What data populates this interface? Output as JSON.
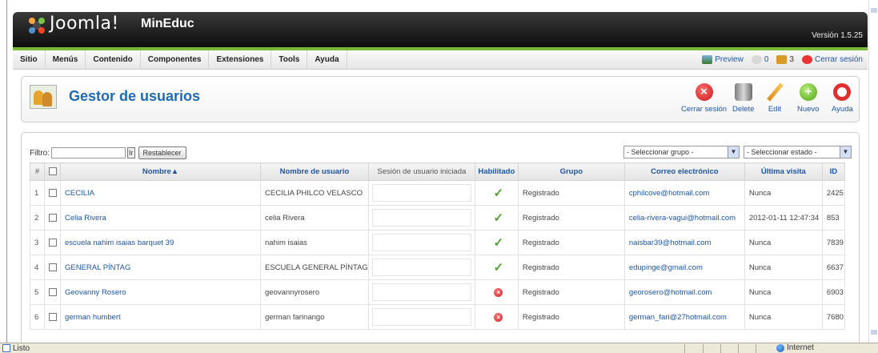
{
  "header": {
    "brand": "Joomla!",
    "site": "MinEduc",
    "version": "Versión 1.5.25"
  },
  "menu": {
    "items": [
      "Sitio",
      "Menús",
      "Contenido",
      "Componentes",
      "Extensiones",
      "Tools",
      "Ayuda"
    ],
    "preview": "Preview",
    "messages": "0",
    "users": "3",
    "logout": "Cerrar sesión"
  },
  "toolbar": {
    "title": "Gestor de usuarios",
    "buttons": [
      "Cerrar sesión",
      "Delete",
      "Edit",
      "Nuevo",
      "Ayuda"
    ]
  },
  "filter": {
    "label": "Filtro:",
    "value": "",
    "go": "Ir",
    "reset": "Restablecer",
    "group_select": "- Seleccionar grupo -",
    "state_select": "- Seleccionar estado -"
  },
  "table": {
    "headers": [
      "#",
      "",
      "Nombre▲",
      "Nombre de usuario",
      "Sesión de usuario iniciada",
      "Habilitado",
      "Grupo",
      "Correo electrónico",
      "Última visita",
      "ID"
    ],
    "rows": [
      {
        "n": "1",
        "name": "CECILIA",
        "username": "CECILIA PHILCO VELASCO",
        "enabled": true,
        "group": "Registrado",
        "email": "cphilcove@hotmail.com",
        "last": "Nunca",
        "id": "2425"
      },
      {
        "n": "2",
        "name": "Celia Rivera",
        "username": "celia Rivera",
        "enabled": true,
        "group": "Registrado",
        "email": "celia-rivera-vagui@hotmail.com",
        "last": "2012-01-11 12:47:34",
        "id": "853"
      },
      {
        "n": "3",
        "name": "escuela nahim isaias barquet 39",
        "username": "nahim isaias",
        "enabled": true,
        "group": "Registrado",
        "email": "naisbar39@hotmail.com",
        "last": "Nunca",
        "id": "7839"
      },
      {
        "n": "4",
        "name": "GENERAL PÍNTAG",
        "username": "ESCUELA GENERAL PÍNTAG",
        "enabled": true,
        "group": "Registrado",
        "email": "edupinge@gmail.com",
        "last": "Nunca",
        "id": "6637"
      },
      {
        "n": "5",
        "name": "Geovanny Rosero",
        "username": "geovannyrosero",
        "enabled": false,
        "group": "Registrado",
        "email": "georosero@hotmail.com",
        "last": "Nunca",
        "id": "6903"
      },
      {
        "n": "6",
        "name": "german humbert",
        "username": "german farinango",
        "enabled": false,
        "group": "Registrado",
        "email": "german_fari@27hotmail.com",
        "last": "Nunca",
        "id": "7680"
      }
    ]
  },
  "status": {
    "left": "Listo",
    "right": "Internet"
  }
}
